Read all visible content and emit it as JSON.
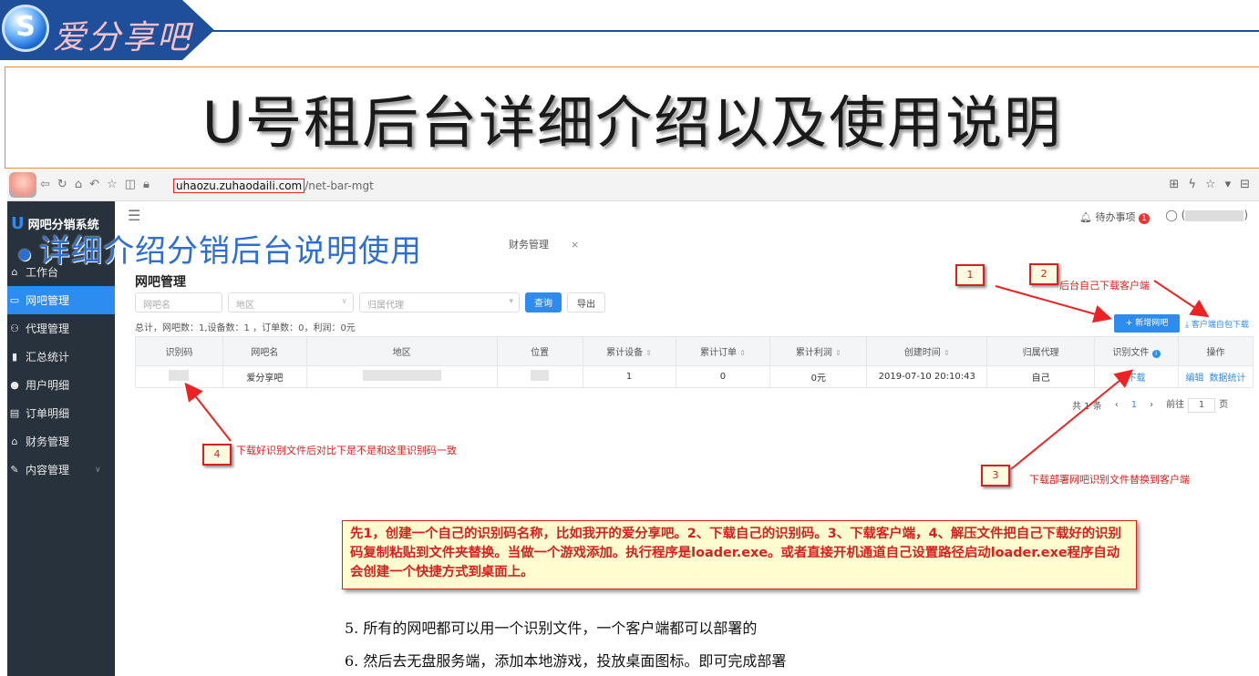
{
  "banner": {
    "logo_letter": "S",
    "logo_text": "爱分享吧"
  },
  "slide_title": "U号租后台详细介绍以及使用说明",
  "browser": {
    "url_host": "uhaozu.zuhaodaili.com",
    "url_path": "/net-bar-mgt"
  },
  "sidebar": {
    "brand": "网吧分销系统",
    "items": [
      {
        "label": "工作台",
        "icon": "home-icon"
      },
      {
        "label": "网吧管理",
        "icon": "monitor-icon"
      },
      {
        "label": "代理管理",
        "icon": "users-icon"
      },
      {
        "label": "汇总统计",
        "icon": "bar-chart-icon"
      },
      {
        "label": "用户明细",
        "icon": "user-icon"
      },
      {
        "label": "订单明细",
        "icon": "list-icon"
      },
      {
        "label": "财务管理",
        "icon": "home-icon"
      },
      {
        "label": "内容管理",
        "icon": "pencil-icon"
      }
    ]
  },
  "topbar": {
    "todo": "待办事项",
    "todo_count": "1",
    "user_open": "(",
    "user_close": ")"
  },
  "overlay_title": "详细介绍分销后台说明使用",
  "tab_finance": "财务管理",
  "page_heading": "网吧管理",
  "filters": {
    "name_placeholder": "网吧名",
    "region_placeholder": "地区",
    "agent_placeholder": "归属代理",
    "search_label": "查询",
    "export_label": "导出"
  },
  "summary": "总计，网吧数：1,设备数：1 ，订单数：0，利润：0元",
  "actions": {
    "add_label": "+ 新增网吧",
    "download_label": "客户端自包下载"
  },
  "table": {
    "headers": [
      "识别码",
      "网吧名",
      "地区",
      "位置",
      "累计设备",
      "累计订单",
      "累计利润",
      "创建时间",
      "归属代理",
      "识别文件",
      "操作"
    ],
    "row": {
      "name": "爱分享吧",
      "devices": "1",
      "orders": "0",
      "profit": "0元",
      "created": "2019-07-10 20:10:43",
      "agent": "自己",
      "download": "下载",
      "edit": "编辑",
      "stats": "数据统计"
    }
  },
  "pager": {
    "total": "共 1 条",
    "current": "1",
    "goto": "前往",
    "page_value": "1",
    "page_unit": "页"
  },
  "annotations": {
    "n1": "1",
    "n2": "2",
    "n3": "3",
    "n4": "4",
    "note2": "后台自己下载客户端",
    "note3": "下载部署网吧识别文件替换到客户端",
    "note4": "下载好识别文件后对比下是不是和这里识别码一致"
  },
  "instruction": "先1，创建一个自己的识别码名称，比如我开的爱分享吧。2、下载自己的识别码。3、下载客户端，4、解压文件把自己下载好的识别码复制粘贴到文件夹替换。当做一个游戏添加。执行程序是loader.exe。或者直接开机通道自己设置路径启动loader.exe程序自动会创建一个快捷方式到桌面上。",
  "steps": [
    "5. 所有的网吧都可以用一个识别文件，一个客户端都可以部署的",
    "6. 然后去无盘服务端，添加本地游戏，投放桌面图标。即可完成部署"
  ],
  "colors": {
    "accent": "#2d8cf0",
    "sidebar": "#28323c",
    "annotation": "#d91f1f",
    "banner": "#1f4f9a"
  }
}
